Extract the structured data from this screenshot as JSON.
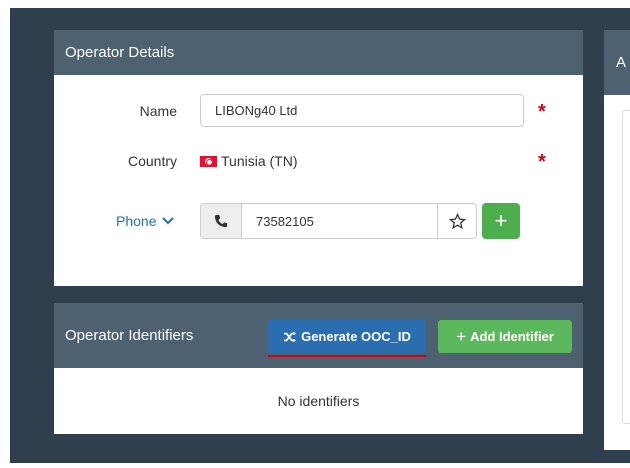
{
  "operator_details": {
    "title": "Operator Details",
    "name_label": "Name",
    "name_value": "LIBONg40 Ltd",
    "country_label": "Country",
    "country_value": "Tunisia (TN)",
    "phone_label": "Phone",
    "phone_value": "73582105",
    "required_mark": "*"
  },
  "operator_identifiers": {
    "title": "Operator Identifiers",
    "generate_label": "Generate OOC_ID",
    "add_label": "Add Identifier",
    "empty_text": "No identifiers"
  },
  "side_panel": {
    "title": "A"
  },
  "icons": {
    "phone": "phone-icon",
    "star": "star-icon",
    "plus": "plus-icon",
    "shuffle": "shuffle-icon",
    "chevron": "chevron-down-icon",
    "flag": "tunisia-flag-icon"
  },
  "colors": {
    "panel_header": "#4d6170",
    "required": "#d0021b",
    "primary": "#2b6eb0",
    "success": "#5cb85c"
  }
}
